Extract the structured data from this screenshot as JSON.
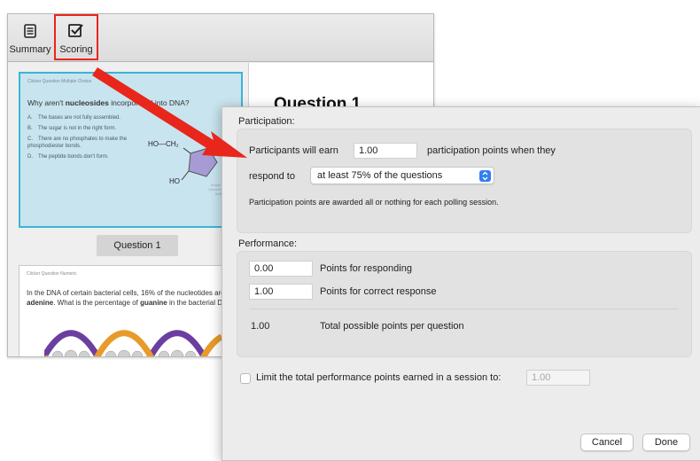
{
  "toolbar": {
    "summary_label": "Summary",
    "summary_icon": "list-document-icon",
    "scoring_label": "Scoring",
    "scoring_icon": "checkbox-check-icon",
    "highlight_color": "#e8261b"
  },
  "slide1": {
    "header": "Clicker Question Multiple Choice",
    "question_pre": "Why aren't ",
    "question_bold": "nucleosides",
    "question_post": " incorporated into DNA?",
    "options": [
      {
        "letter": "A.",
        "text": "The bases are not fully assembled."
      },
      {
        "letter": "B.",
        "text": "The sugar is not in the right form."
      },
      {
        "letter": "C.",
        "text": "There are no phosphates to make the phosphodiester bonds."
      },
      {
        "letter": "D.",
        "text": "The peptide bonds don't form."
      }
    ],
    "chem_top": "HO—CH₂",
    "chem_bottom": "HO",
    "credit": "Image from biochemistry textbook",
    "label": "Question 1"
  },
  "slide2": {
    "header": "Clicker Question Numeric",
    "q_pre": "In the DNA of certain bacterial cells, 16% of the nucleotides are ",
    "q_bold1": "adenine",
    "q_mid": ". What is the percentage of ",
    "q_bold2": "guanine",
    "q_post": " in the bacterial DNA?"
  },
  "main": {
    "question_title": "Question 1"
  },
  "dialog": {
    "participation": {
      "label": "Participation:",
      "earn_prefix": "Participants will earn",
      "earn_value": "1.00",
      "earn_suffix": "participation points when they",
      "respond_label": "respond to",
      "respond_selected": "at least 75% of the questions",
      "note": "Participation points are awarded all or nothing for each polling session."
    },
    "performance": {
      "label": "Performance:",
      "responding_value": "0.00",
      "responding_label": "Points for responding",
      "correct_value": "1.00",
      "correct_label": "Points for correct response",
      "total_value": "1.00",
      "total_label": "Total possible points per question"
    },
    "limit": {
      "label": "Limit the total performance points earned in a session to:",
      "value": "1.00",
      "checked": false
    },
    "cancel_label": "Cancel",
    "done_label": "Done",
    "accent_color": "#2f7ff0"
  }
}
